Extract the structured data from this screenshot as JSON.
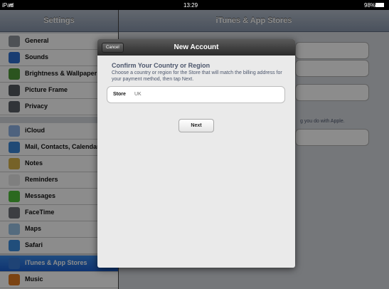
{
  "status_bar": {
    "device": "iPad",
    "time": "13:29",
    "battery": "98%"
  },
  "master": {
    "title": "Settings",
    "items": [
      {
        "label": "General",
        "icon": "gear-icon",
        "color": "#8e949c"
      },
      {
        "label": "Sounds",
        "icon": "speaker-icon",
        "color": "#2f6fd0"
      },
      {
        "label": "Brightness & Wallpaper",
        "icon": "flower-icon",
        "color": "#4f9a3a"
      },
      {
        "label": "Picture Frame",
        "icon": "picture-frame-icon",
        "color": "#555a60"
      },
      {
        "label": "Privacy",
        "icon": "hand-icon",
        "color": "#5a5f66"
      },
      {
        "label": "iCloud",
        "icon": "cloud-icon",
        "color": "#8fb2e6"
      },
      {
        "label": "Mail, Contacts, Calendars",
        "icon": "mail-icon",
        "color": "#3b87d8"
      },
      {
        "label": "Notes",
        "icon": "notes-icon",
        "color": "#d8b24a"
      },
      {
        "label": "Reminders",
        "icon": "reminders-icon",
        "color": "#e8e8e8"
      },
      {
        "label": "Messages",
        "icon": "messages-icon",
        "color": "#4fbf3b"
      },
      {
        "label": "FaceTime",
        "icon": "facetime-icon",
        "color": "#6d7178"
      },
      {
        "label": "Maps",
        "icon": "maps-icon",
        "color": "#9ac3e6"
      },
      {
        "label": "Safari",
        "icon": "safari-icon",
        "color": "#3d8ee0"
      },
      {
        "label": "iTunes & App Stores",
        "icon": "app-store-icon",
        "color": "#3a7bd5"
      },
      {
        "label": "Music",
        "icon": "music-icon",
        "color": "#e07a22"
      }
    ],
    "selected_index": 13
  },
  "detail": {
    "title": "iTunes & App Stores",
    "note_fragment": "g you do with Apple."
  },
  "modal": {
    "title": "New Account",
    "cancel_label": "Cancel",
    "heading": "Confirm Your Country or Region",
    "description": "Choose a country or region for the Store that will match the billing address for your payment method, then tap Next.",
    "store_label": "Store",
    "store_value": "UK",
    "next_label": "Next"
  }
}
